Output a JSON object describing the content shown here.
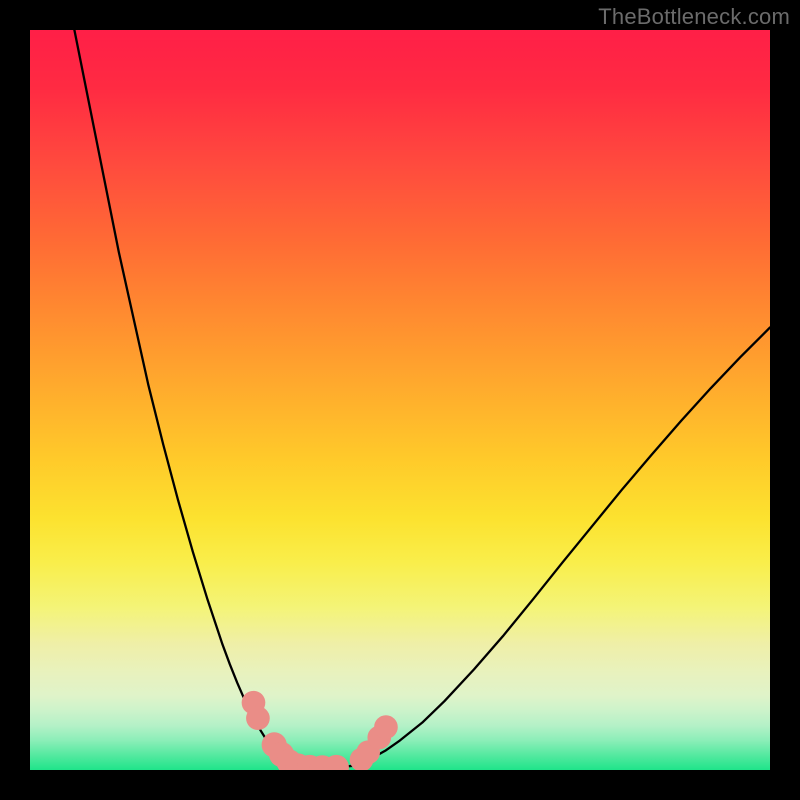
{
  "watermark": "TheBottleneck.com",
  "chart_data": {
    "type": "line",
    "title": "",
    "xlabel": "",
    "ylabel": "",
    "xlim": [
      0,
      100
    ],
    "ylim": [
      0,
      100
    ],
    "background_gradient_top_color": "#ff1f47",
    "background_gradient_bottom_color": "#1fe48a",
    "series": [
      {
        "name": "left-curve",
        "stroke": "#000000",
        "x": [
          6,
          8,
          10,
          12,
          14,
          16,
          18,
          20,
          22,
          24,
          26,
          27,
          28,
          29,
          30,
          31,
          32,
          33,
          34,
          35
        ],
        "y": [
          100,
          90,
          80,
          70,
          61,
          52,
          44,
          36.5,
          29.5,
          23,
          17,
          14.3,
          11.8,
          9.5,
          7.4,
          5.6,
          4.0,
          2.6,
          1.5,
          0.6
        ]
      },
      {
        "name": "flat-bottom",
        "stroke": "#000000",
        "x": [
          35,
          38,
          41,
          44
        ],
        "y": [
          0.6,
          0.3,
          0.3,
          0.6
        ]
      },
      {
        "name": "right-curve",
        "stroke": "#000000",
        "x": [
          44,
          46,
          48,
          50,
          53,
          56,
          60,
          64,
          68,
          72,
          76,
          80,
          84,
          88,
          92,
          96,
          100
        ],
        "y": [
          0.6,
          1.5,
          2.6,
          4.0,
          6.4,
          9.3,
          13.6,
          18.2,
          23.1,
          28.1,
          33.0,
          37.9,
          42.6,
          47.2,
          51.6,
          55.8,
          59.8
        ]
      }
    ],
    "markers": [
      {
        "name": "left-marker-1",
        "x": 30.2,
        "y": 9.1,
        "r": 1.6
      },
      {
        "name": "left-marker-2",
        "x": 30.8,
        "y": 7.0,
        "r": 1.6
      },
      {
        "name": "left-marker-3",
        "x": 33.0,
        "y": 3.4,
        "r": 1.7
      },
      {
        "name": "left-marker-4",
        "x": 34.0,
        "y": 2.1,
        "r": 1.7
      },
      {
        "name": "left-marker-5",
        "x": 35.0,
        "y": 1.1,
        "r": 1.7
      },
      {
        "name": "left-marker-6",
        "x": 36.2,
        "y": 0.55,
        "r": 1.7
      },
      {
        "name": "left-marker-7",
        "x": 37.8,
        "y": 0.35,
        "r": 1.7
      },
      {
        "name": "left-marker-8",
        "x": 39.5,
        "y": 0.3,
        "r": 1.7
      },
      {
        "name": "left-marker-9",
        "x": 41.4,
        "y": 0.35,
        "r": 1.7
      },
      {
        "name": "right-marker-1",
        "x": 44.8,
        "y": 1.4,
        "r": 1.6
      },
      {
        "name": "right-marker-2",
        "x": 45.7,
        "y": 2.4,
        "r": 1.6
      },
      {
        "name": "right-marker-3",
        "x": 47.2,
        "y": 4.4,
        "r": 1.6
      },
      {
        "name": "right-marker-4",
        "x": 48.1,
        "y": 5.8,
        "r": 1.6
      }
    ],
    "marker_fill": "#ea8d87",
    "marker_stroke": "#ea8d87"
  }
}
